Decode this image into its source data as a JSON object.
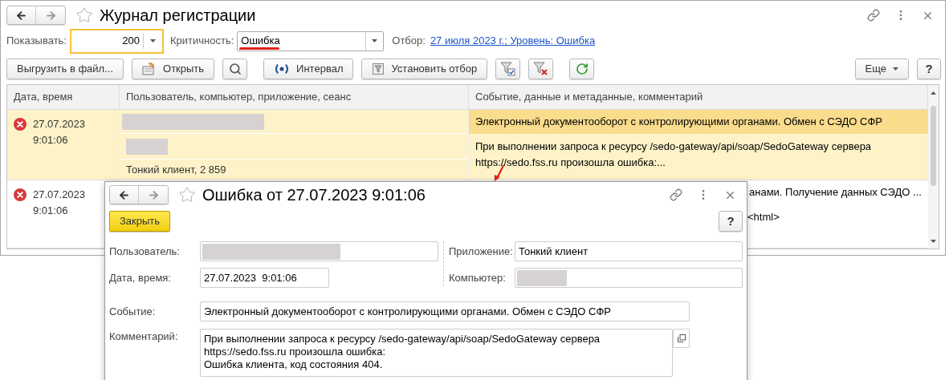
{
  "window": {
    "title": "Журнал регистрации"
  },
  "filters": {
    "show_label": "Показывать:",
    "show_value": "200",
    "criticality_label": "Критичность:",
    "criticality_value": "Ошибка",
    "selection_label": "Отбор:",
    "selection_link": "27 июля 2023 г.; Уровень: Ошибка"
  },
  "toolbar": [
    {
      "kind": "text",
      "label": "Выгрузить в файл..."
    },
    {
      "kind": "icon_text",
      "label": "Открыть"
    },
    {
      "kind": "icon"
    },
    {
      "kind": "icon_text",
      "label": "Интервал"
    },
    {
      "kind": "icon_text",
      "label": "Установить отбор"
    },
    {
      "kind": "icon"
    },
    {
      "kind": "icon"
    },
    {
      "kind": "icon"
    }
  ],
  "toolbar_right": {
    "more": "Еще",
    "help": "?"
  },
  "table": {
    "columns": [
      "Дата, время",
      "Пользователь, компьютер, приложение, сеанс",
      "Событие, данные и метаданные, комментарий"
    ],
    "rows": [
      {
        "selected": true,
        "date": "27.07.2023",
        "time": "9:01:06",
        "application": "Тонкий клиент, 2 859",
        "event": "Электронный документооборот с контролирующими органами. Обмен с СЭДО СФР",
        "comment": "При выполнении запроса к ресурсу /sedo-gateway/api/soap/SedoGateway сервера https://sedo.fss.ru произошла ошибка:..."
      },
      {
        "selected": false,
        "date": "27.07.2023",
        "time": "9:01:06",
        "event": "анами. Получение данных СЭДО ...",
        "comment": "<html>"
      }
    ]
  },
  "dialog": {
    "title": "Ошибка от 27.07.2023 9:01:06",
    "close_button": "Закрыть",
    "help": "?",
    "user_label": "Пользователь:",
    "datetime_label": "Дата, время:",
    "datetime_value": "27.07.2023  9:01:06",
    "application_label": "Приложение:",
    "application_value": "Тонкий клиент",
    "computer_label": "Компьютер:",
    "event_label": "Событие:",
    "event_value": "Электронный документооборот с контролирующими органами. Обмен с СЭДО СФР",
    "comment_label": "Комментарий:",
    "comment_lines": [
      "При выполнении запроса к ресурсу /sedo-gateway/api/soap/SedoGateway сервера",
      "https://sedo.fss.ru произошла ошибка:",
      "Ошибка клиента, код состояния 404."
    ]
  }
}
